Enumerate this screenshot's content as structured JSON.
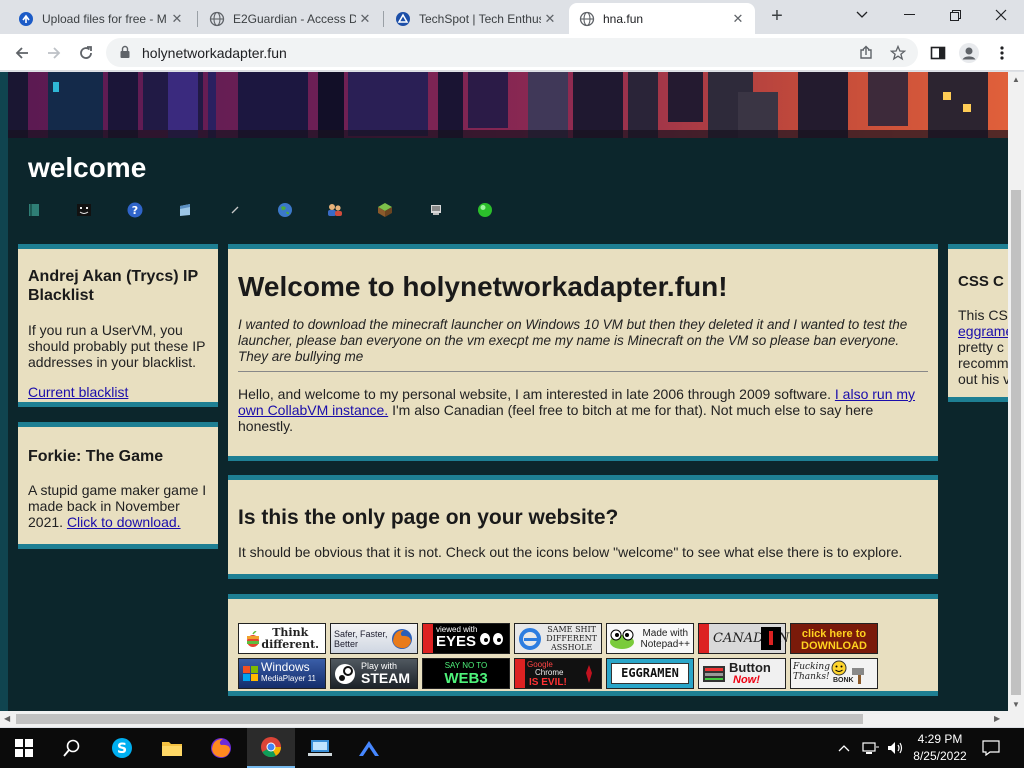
{
  "browser": {
    "tabs": [
      {
        "title": "Upload files for free - M",
        "icon": "upload-favicon"
      },
      {
        "title": "E2Guardian - Access De",
        "icon": "globe-favicon"
      },
      {
        "title": "TechSpot | Tech Enthus",
        "icon": "techspot-favicon"
      },
      {
        "title": "hna.fun",
        "icon": "globe-favicon"
      }
    ],
    "url": "holynetworkadapter.fun",
    "new_tab": "+"
  },
  "site": {
    "title": "welcome",
    "nav_icons": [
      "book-icon",
      "face-icon",
      "help-icon",
      "window-icon",
      "pen-icon",
      "globe-icon",
      "users-icon",
      "cube-icon",
      "monitor-icon",
      "green-orb-icon"
    ]
  },
  "left": {
    "blacklist": {
      "heading": "Andrej Akan (Trycs) IP Blacklist",
      "text": "If you run a UserVM, you should probably put these IP addresses in your blacklist.",
      "link": "Current blacklist"
    },
    "forkie": {
      "heading": "Forkie: The Game",
      "text": "A stupid game maker game I made back in November 2021.",
      "link": "Click to download."
    }
  },
  "main": {
    "heading": "Welcome to holynetworkadapter.fun!",
    "quote": "I wanted to download the minecraft launcher on Windows 10 VM but then they deleted it and I wanted to test the launcher, please ban everyone on the vm execpt me my name is Minecraft on the VM so please ban everyone. They are bullying me",
    "intro_a": "Hello, and welcome to my personal website, I am interested in late 2006 through 2009 software.",
    "intro_link": "I also run my own CollabVM instance.",
    "intro_b": "I'm also Canadian (feel free to bitch at me for that). Not much else to say here honestly.",
    "only_heading": "Is this the only page on your website?",
    "only_text": "It should be obvious that it is not. Check out the icons below \"welcome\" to see what else there is to explore."
  },
  "right": {
    "heading": "CSS C",
    "line1": "This CS",
    "link": "eggrame",
    "line3": "pretty c",
    "line4": "recomm",
    "line5": "out his v"
  },
  "buttons": [
    {
      "l1": "Think",
      "l2": "different."
    },
    {
      "l1": "Safer, Faster,",
      "l2": "Better"
    },
    {
      "l1": "viewed with",
      "l2": "EYES"
    },
    {
      "l1": "SAME SHIT",
      "l2": "DIFFERENT",
      "l3": "ASSHOLE"
    },
    {
      "l1": "Made with",
      "l2": "Notepad++"
    },
    {
      "l1": "CANADIAN"
    },
    {
      "l1": "click here to",
      "l2": "DOWNLOAD"
    },
    {
      "l1": "Windows",
      "l2": "MediaPlayer 11"
    },
    {
      "l1": "Play with",
      "l2": "STEAM"
    },
    {
      "l1": "SAY NO TO",
      "l2": "WEB3"
    },
    {
      "l1": "Google",
      "l2": "Chrome",
      "l3": "IS EVIL!"
    },
    {
      "l1": "EGGRAMEN"
    },
    {
      "l1": "Button",
      "l2": "Now!"
    },
    {
      "l1": "Fucking",
      "l2": "Thanks!",
      "l3": "BONK"
    }
  ],
  "taskbar": {
    "time": "4:29 PM",
    "date": "8/25/2022"
  },
  "colors": {
    "page_bg": "#0c262c",
    "panel_bg": "#e8dfc0",
    "panel_border": "#1e7f93"
  }
}
